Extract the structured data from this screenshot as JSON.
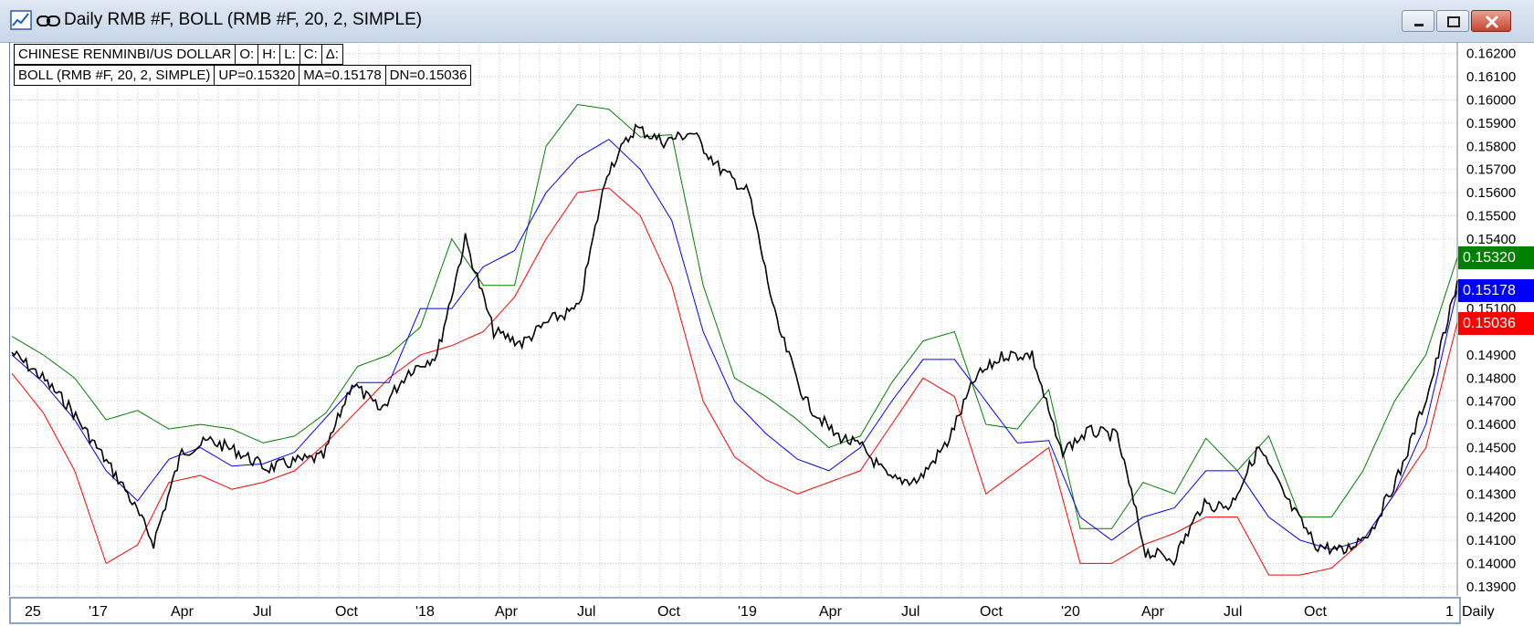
{
  "window": {
    "title": "Daily RMB #F, BOLL (RMB #F, 20, 2, SIMPLE)",
    "icons": [
      "chart-icon",
      "link-icon",
      "minimize-icon",
      "restore-icon",
      "close-icon"
    ]
  },
  "info": {
    "row1": [
      "CHINESE RENMINBI/US DOLLAR",
      "O:",
      "H:",
      "L:",
      "C:",
      "Δ:"
    ],
    "row2": [
      "BOLL (RMB #F, 20, 2, SIMPLE)",
      "UP=0.15320",
      "MA=0.15178",
      "DN=0.15036"
    ]
  },
  "price_tags": {
    "up": {
      "label": "0.15320",
      "value": 0.1532,
      "color": "#008000"
    },
    "ma": {
      "label": "0.15178",
      "value": 0.15178,
      "color": "#0000ff"
    },
    "down": {
      "label": "0.15036",
      "value": 0.15036,
      "color": "#ff0000"
    }
  },
  "period_label": "Daily",
  "chart_data": {
    "type": "line",
    "title": "Daily RMB #F, BOLL (RMB #F, 20, 2, SIMPLE)",
    "x_tick_labels": [
      "25",
      "'17",
      "Apr",
      "Jul",
      "Oct",
      "'18",
      "Apr",
      "Jul",
      "Oct",
      "'19",
      "Apr",
      "Jul",
      "Oct",
      "'20",
      "Apr",
      "Jul",
      "Oct",
      "1"
    ],
    "y_ticks": [
      0.139,
      0.14,
      0.141,
      0.142,
      0.143,
      0.144,
      0.145,
      0.146,
      0.147,
      0.148,
      0.149,
      0.151,
      0.154,
      0.155,
      0.156,
      0.157,
      0.158,
      0.159,
      0.16,
      0.161,
      0.162
    ],
    "y_tick_labels": [
      "0.13900",
      "0.14000",
      "0.14100",
      "0.14200",
      "0.14300",
      "0.14400",
      "0.14500",
      "0.14600",
      "0.14700",
      "0.14800",
      "0.14900",
      "0.15100",
      "0.15400",
      "0.15500",
      "0.15600",
      "0.15700",
      "0.15800",
      "0.15900",
      "0.16000",
      "0.16100",
      "0.16200"
    ],
    "ylim": [
      0.1386,
      0.1625
    ],
    "grid": true,
    "colors": {
      "price": "#000000",
      "upper": "#008000",
      "middle": "#0000ff",
      "lower": "#ff0000"
    },
    "x": [
      0,
      2,
      4,
      6,
      8,
      10,
      12,
      14,
      16,
      18,
      20,
      22,
      24,
      26,
      28,
      30,
      32,
      34,
      36,
      38,
      40,
      42,
      44,
      46,
      48,
      50,
      52,
      54,
      56,
      58,
      60,
      62,
      64,
      66,
      68,
      70,
      72,
      74,
      76,
      78,
      80,
      82,
      84,
      86,
      88,
      90,
      92,
      94,
      96,
      98,
      100
    ],
    "close": [
      0.1491,
      0.1481,
      0.1468,
      0.145,
      0.1432,
      0.1409,
      0.1448,
      0.1453,
      0.1448,
      0.1441,
      0.1444,
      0.1446,
      0.1478,
      0.1466,
      0.1483,
      0.149,
      0.154,
      0.15,
      0.1495,
      0.1505,
      0.151,
      0.1569,
      0.1588,
      0.1582,
      0.1586,
      0.157,
      0.156,
      0.1503,
      0.147,
      0.1456,
      0.145,
      0.1436,
      0.1436,
      0.1452,
      0.148,
      0.149,
      0.149,
      0.1448,
      0.1457,
      0.1455,
      0.1405,
      0.1402,
      0.1425,
      0.1425,
      0.145,
      0.1427,
      0.1408,
      0.1405,
      0.1415,
      0.144,
      0.1475,
      0.152
    ],
    "upper": [
      0.1498,
      0.149,
      0.148,
      0.1462,
      0.1466,
      0.1458,
      0.146,
      0.1458,
      0.1452,
      0.1455,
      0.1465,
      0.1485,
      0.149,
      0.1502,
      0.154,
      0.152,
      0.152,
      0.158,
      0.1598,
      0.1596,
      0.1584,
      0.1585,
      0.152,
      0.148,
      0.1472,
      0.1462,
      0.145,
      0.1455,
      0.1478,
      0.1496,
      0.15,
      0.146,
      0.1458,
      0.1475,
      0.1415,
      0.1415,
      0.1435,
      0.143,
      0.1454,
      0.144,
      0.1455,
      0.142,
      0.142,
      0.144,
      0.147,
      0.149,
      0.1532
    ],
    "middle": [
      0.149,
      0.1478,
      0.1462,
      0.144,
      0.1427,
      0.1445,
      0.145,
      0.1442,
      0.1443,
      0.1448,
      0.1463,
      0.1478,
      0.1478,
      0.151,
      0.151,
      0.1528,
      0.1535,
      0.156,
      0.1575,
      0.1583,
      0.157,
      0.1548,
      0.15,
      0.147,
      0.1456,
      0.1445,
      0.144,
      0.145,
      0.147,
      0.1488,
      0.1488,
      0.147,
      0.1452,
      0.1453,
      0.142,
      0.141,
      0.142,
      0.1424,
      0.144,
      0.144,
      0.142,
      0.141,
      0.1406,
      0.141,
      0.143,
      0.146,
      0.1518
    ],
    "lower": [
      0.1482,
      0.1465,
      0.144,
      0.14,
      0.1408,
      0.1435,
      0.1438,
      0.1432,
      0.1435,
      0.144,
      0.1452,
      0.1466,
      0.148,
      0.149,
      0.1494,
      0.15,
      0.1515,
      0.154,
      0.156,
      0.1562,
      0.155,
      0.152,
      0.147,
      0.1446,
      0.1436,
      0.143,
      0.1435,
      0.144,
      0.146,
      0.148,
      0.1472,
      0.143,
      0.144,
      0.145,
      0.14,
      0.14,
      0.1408,
      0.1413,
      0.142,
      0.142,
      0.1395,
      0.1395,
      0.1398,
      0.141,
      0.143,
      0.145,
      0.1504
    ]
  }
}
